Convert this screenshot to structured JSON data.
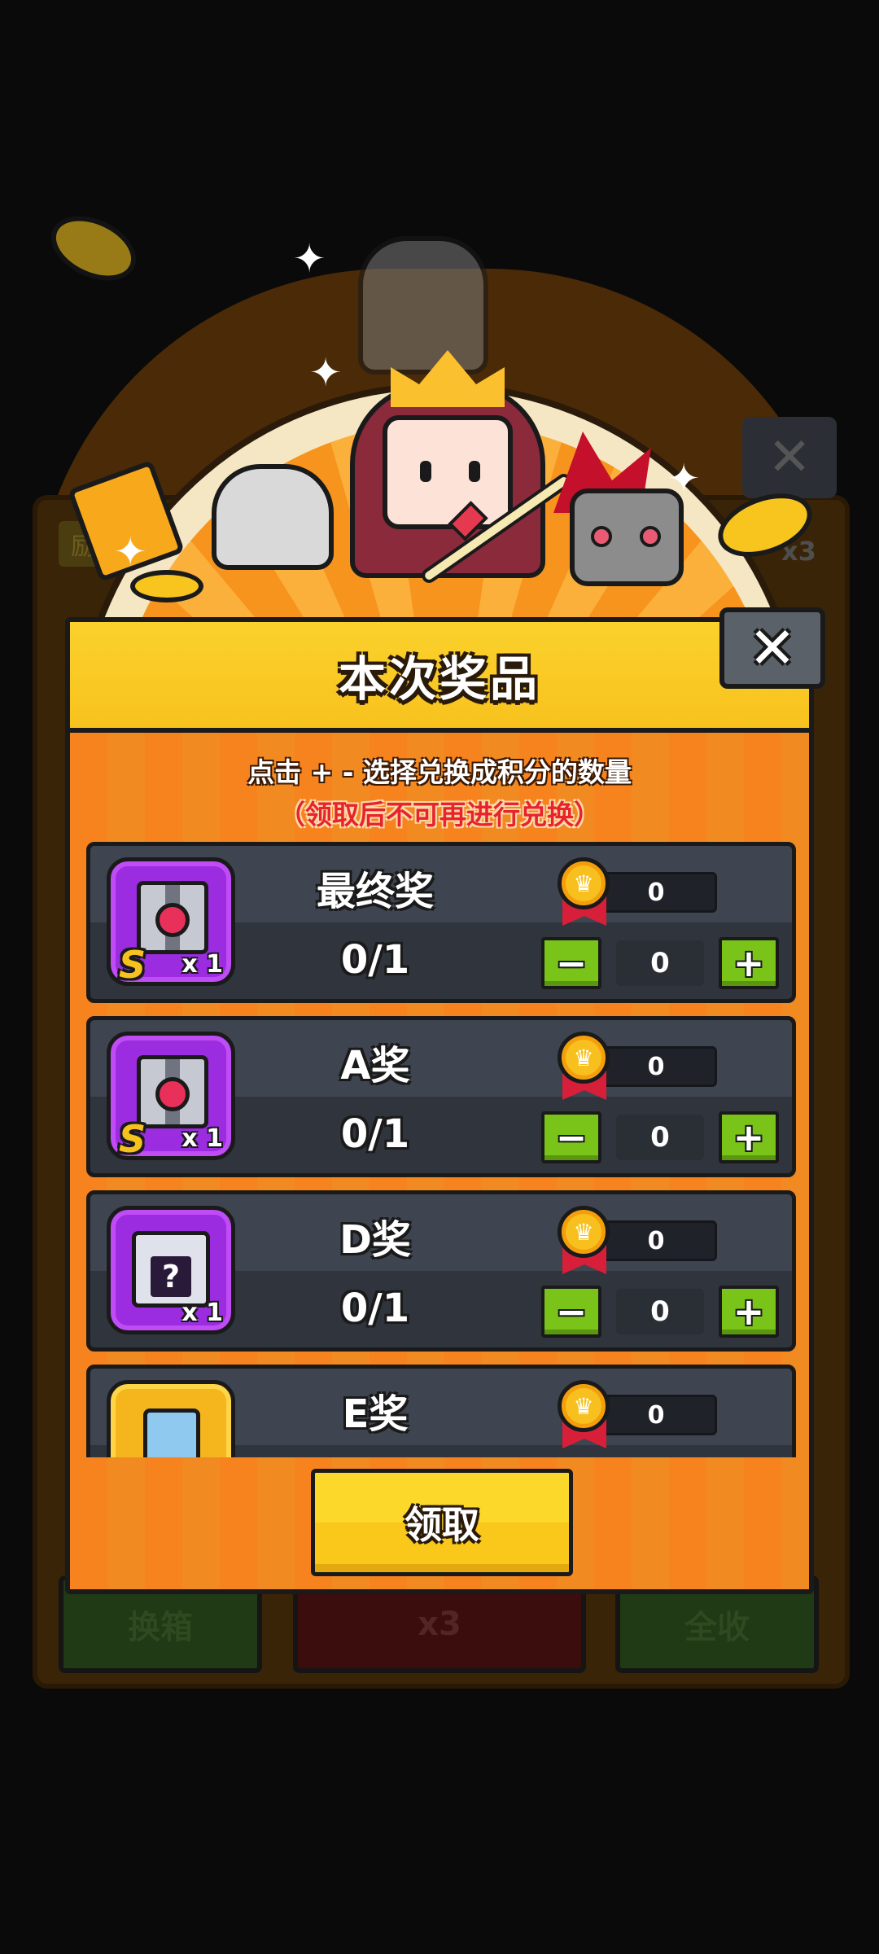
{
  "background": {
    "tag": "励",
    "top_badge": "x3",
    "buttons": {
      "left": "换箱",
      "middle": "x3",
      "right": "全收"
    }
  },
  "modal": {
    "title": "本次奖品",
    "instruction": "点击 + - 选择兑换成积分的数量",
    "warning": "（领取后不可再进行兑换）",
    "claim_label": "领取",
    "close_glyph": "✕"
  },
  "prizes": [
    {
      "name": "最终奖",
      "progress": "0/1",
      "points": "0",
      "selected": "0",
      "grade": "S",
      "qty": "x 1",
      "icon": "treasure-chest-icon"
    },
    {
      "name": "A奖",
      "progress": "0/1",
      "points": "0",
      "selected": "0",
      "grade": "S",
      "qty": "x 1",
      "icon": "treasure-chest-icon"
    },
    {
      "name": "D奖",
      "progress": "0/1",
      "points": "0",
      "selected": "0",
      "grade": "",
      "qty": "x 1",
      "icon": "mystery-box-icon"
    },
    {
      "name": "E奖",
      "points": "0",
      "icon": "key-item-icon"
    }
  ],
  "stepper": {
    "minus": "−",
    "plus": "+"
  },
  "colors": {
    "accent_orange": "#f7831f",
    "header_yellow": "#fbd12c",
    "stepper_green": "#7ac41a",
    "warning_red": "#e8232b",
    "row_gray": "#3f4550"
  }
}
